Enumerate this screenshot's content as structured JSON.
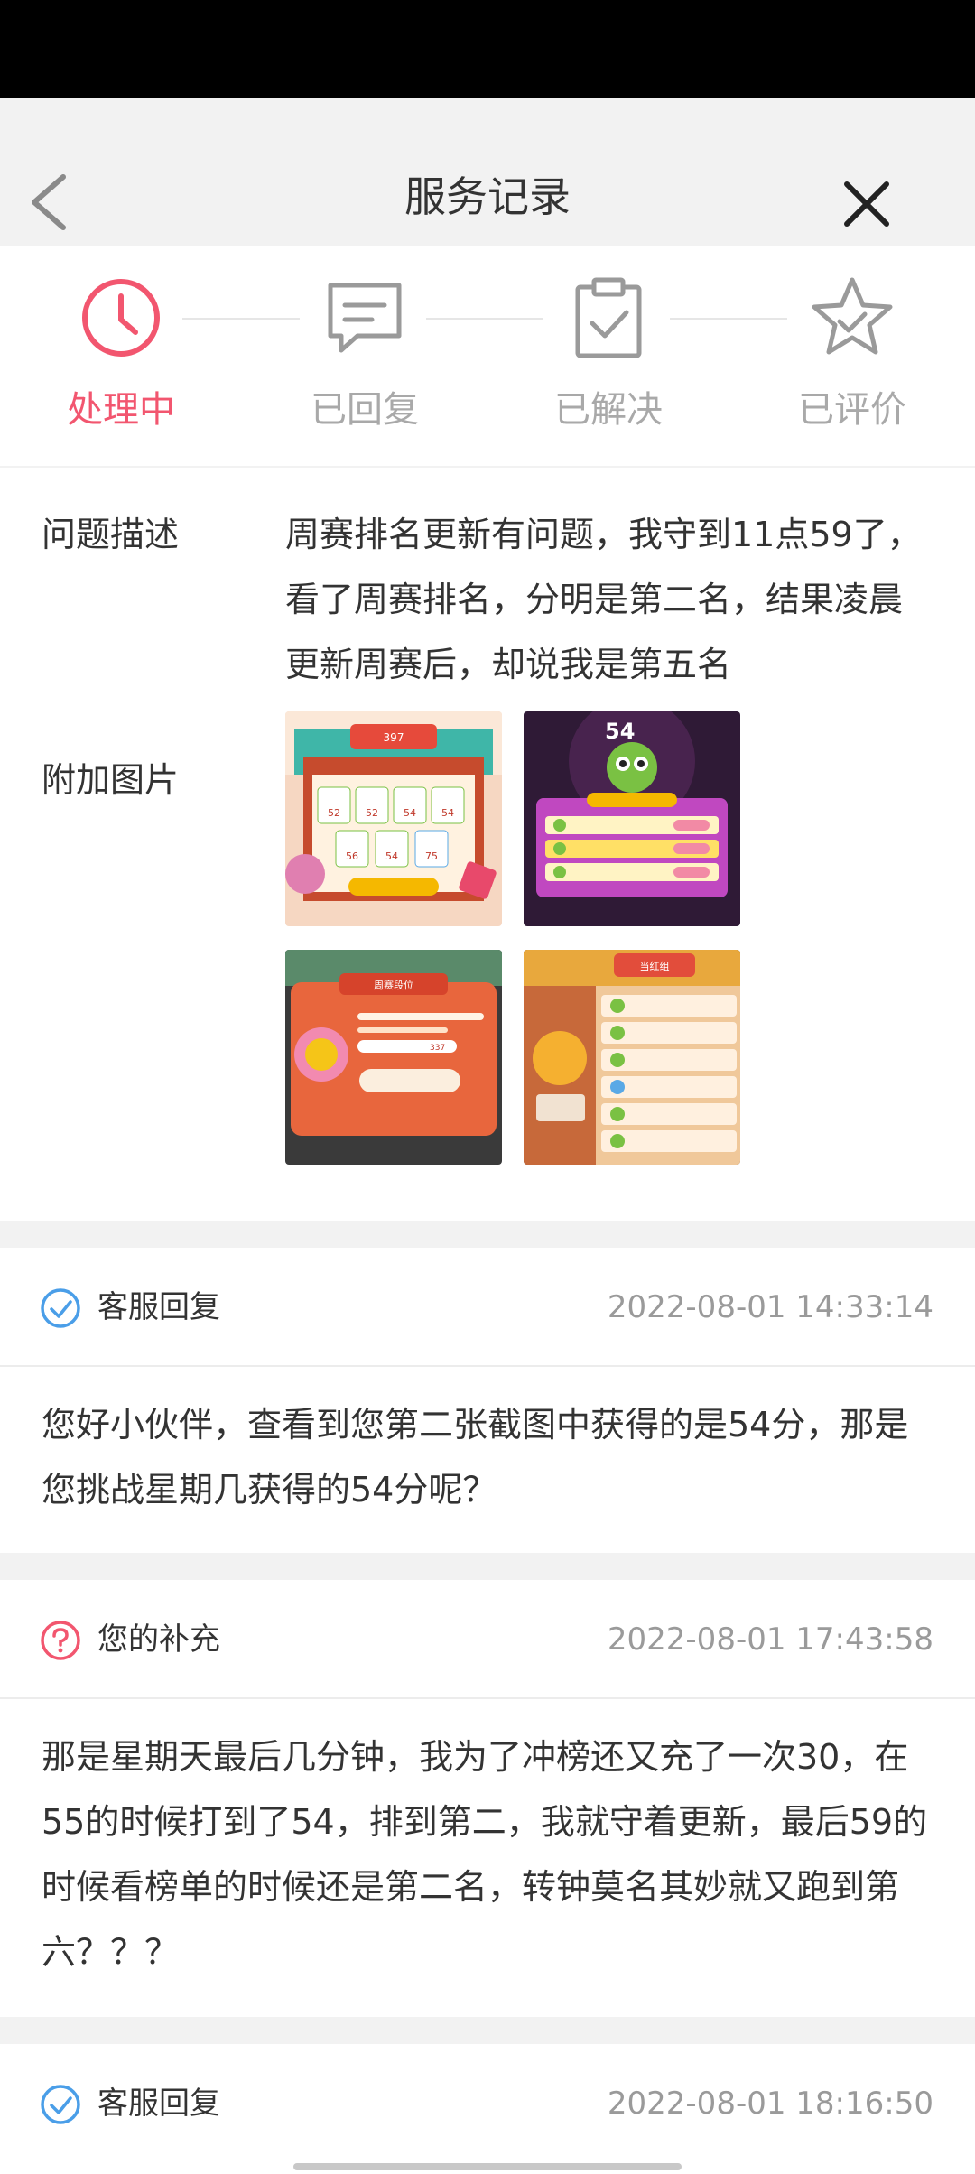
{
  "title_bar": {
    "title": "服务记录",
    "back_icon": "chevron-left-icon",
    "close_icon": "close-icon"
  },
  "steps": [
    {
      "label": "处理中",
      "icon": "clock-icon",
      "active": true
    },
    {
      "label": "已回复",
      "icon": "chat-bubble-icon",
      "active": false
    },
    {
      "label": "已解决",
      "icon": "clipboard-check-icon",
      "active": false
    },
    {
      "label": "已评价",
      "icon": "star-check-icon",
      "active": false
    }
  ],
  "colors": {
    "accent": "#f2566f",
    "inactive": "#a9a9a9",
    "reply_icon": "#4a9ee8",
    "supplement_icon": "#f2566f"
  },
  "problem": {
    "label": "问题描述",
    "text": "周赛排名更新有问题，我守到11点59了，看了周赛排名，分明是第二名，结果凌晨更新周赛后，却说我是第五名"
  },
  "attachments": {
    "label": "附加图片",
    "images": [
      {
        "name": "weekly-match-screenshot",
        "texts": [
          "397",
          "52",
          "52",
          "54",
          "54",
          "56",
          "54",
          "75"
        ]
      },
      {
        "name": "ranking-screenshot",
        "texts": [
          "54"
        ]
      },
      {
        "name": "result-popup-screenshot",
        "texts": [
          "周赛段位",
          "337"
        ]
      },
      {
        "name": "leaderboard-screenshot",
        "texts": [
          "当红组"
        ]
      }
    ]
  },
  "replies": [
    {
      "type": "service",
      "icon": "check-circle-icon",
      "author": "客服回复",
      "time": "2022-08-01 14:33:14",
      "text": "您好小伙伴，查看到您第二张截图中获得的是54分，那是您挑战星期几获得的54分呢？"
    },
    {
      "type": "supplement",
      "icon": "question-circle-icon",
      "author": "您的补充",
      "time": "2022-08-01 17:43:58",
      "text": "那是星期天最后几分钟，我为了冲榜还又充了一次30，在55的时候打到了54，排到第二，我就守着更新，最后59的时候看榜单的时候还是第二名，转钟莫名其妙就又跑到第六？？？"
    },
    {
      "type": "service",
      "icon": "check-circle-icon",
      "author": "客服回复",
      "time": "2022-08-01 18:16:50",
      "text": ""
    }
  ]
}
